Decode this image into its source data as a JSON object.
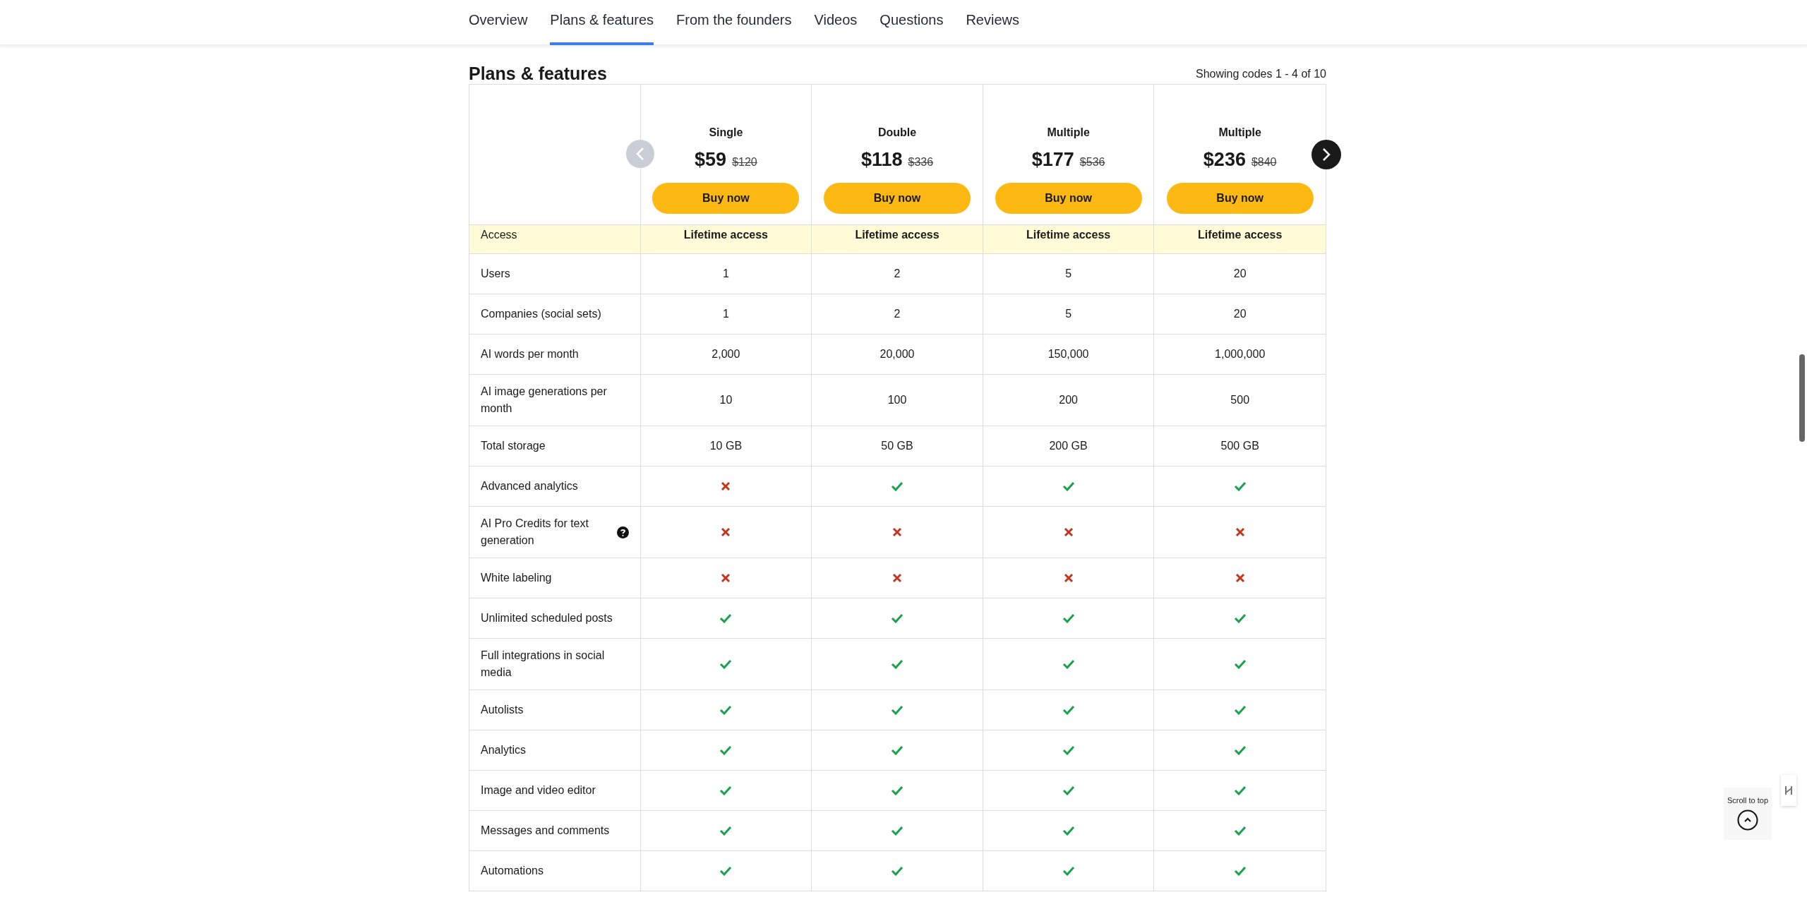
{
  "tabs": [
    {
      "label": "Overview",
      "selected": false
    },
    {
      "label": "Plans & features",
      "selected": true
    },
    {
      "label": "From the founders",
      "selected": false
    },
    {
      "label": "Videos",
      "selected": false
    },
    {
      "label": "Questions",
      "selected": false
    },
    {
      "label": "Reviews",
      "selected": false
    }
  ],
  "section_title": "Plans & features",
  "showing": "Showing codes 1 - 4 of 10",
  "carousel": {
    "prev_disabled": true,
    "next_disabled": false
  },
  "plans": [
    {
      "name": "Single",
      "price": "$59",
      "old_price": "$120",
      "button": "Buy now"
    },
    {
      "name": "Double",
      "price": "$118",
      "old_price": "$336",
      "button": "Buy now"
    },
    {
      "name": "Multiple",
      "price": "$177",
      "old_price": "$536",
      "button": "Buy now"
    },
    {
      "name": "Multiple",
      "price": "$236",
      "old_price": "$840",
      "button": "Buy now"
    }
  ],
  "rows": [
    {
      "label": "Access",
      "highlight": true,
      "help": false,
      "cells": [
        {
          "kind": "text",
          "text": "Lifetime access"
        },
        {
          "kind": "text",
          "text": "Lifetime access"
        },
        {
          "kind": "text",
          "text": "Lifetime access"
        },
        {
          "kind": "text",
          "text": "Lifetime access"
        }
      ]
    },
    {
      "label": "Users",
      "highlight": false,
      "help": false,
      "cells": [
        {
          "kind": "text",
          "text": "1"
        },
        {
          "kind": "text",
          "text": "2"
        },
        {
          "kind": "text",
          "text": "5"
        },
        {
          "kind": "text",
          "text": "20"
        }
      ]
    },
    {
      "label": "Companies (social sets)",
      "highlight": false,
      "help": false,
      "cells": [
        {
          "kind": "text",
          "text": "1"
        },
        {
          "kind": "text",
          "text": "2"
        },
        {
          "kind": "text",
          "text": "5"
        },
        {
          "kind": "text",
          "text": "20"
        }
      ]
    },
    {
      "label": "AI words per month",
      "highlight": false,
      "help": false,
      "cells": [
        {
          "kind": "text",
          "text": "2,000"
        },
        {
          "kind": "text",
          "text": "20,000"
        },
        {
          "kind": "text",
          "text": "150,000"
        },
        {
          "kind": "text",
          "text": "1,000,000"
        }
      ]
    },
    {
      "label": "AI image generations per month",
      "highlight": false,
      "help": false,
      "cells": [
        {
          "kind": "text",
          "text": "10"
        },
        {
          "kind": "text",
          "text": "100"
        },
        {
          "kind": "text",
          "text": "200"
        },
        {
          "kind": "text",
          "text": "500"
        }
      ]
    },
    {
      "label": "Total storage",
      "highlight": false,
      "help": false,
      "cells": [
        {
          "kind": "text",
          "text": "10 GB"
        },
        {
          "kind": "text",
          "text": "50 GB"
        },
        {
          "kind": "text",
          "text": "200 GB"
        },
        {
          "kind": "text",
          "text": "500 GB"
        }
      ]
    },
    {
      "label": "Advanced analytics",
      "highlight": false,
      "help": false,
      "cells": [
        {
          "kind": "cross"
        },
        {
          "kind": "check"
        },
        {
          "kind": "check"
        },
        {
          "kind": "check"
        }
      ]
    },
    {
      "label": "AI Pro Credits for text generation",
      "highlight": false,
      "help": true,
      "cells": [
        {
          "kind": "cross"
        },
        {
          "kind": "cross"
        },
        {
          "kind": "cross"
        },
        {
          "kind": "cross"
        }
      ]
    },
    {
      "label": "White labeling",
      "highlight": false,
      "help": false,
      "cells": [
        {
          "kind": "cross"
        },
        {
          "kind": "cross"
        },
        {
          "kind": "cross"
        },
        {
          "kind": "cross"
        }
      ]
    },
    {
      "label": "Unlimited scheduled posts",
      "highlight": false,
      "help": false,
      "cells": [
        {
          "kind": "check"
        },
        {
          "kind": "check"
        },
        {
          "kind": "check"
        },
        {
          "kind": "check"
        }
      ]
    },
    {
      "label": "Full integrations in social media",
      "highlight": false,
      "help": false,
      "cells": [
        {
          "kind": "check"
        },
        {
          "kind": "check"
        },
        {
          "kind": "check"
        },
        {
          "kind": "check"
        }
      ]
    },
    {
      "label": "Autolists",
      "highlight": false,
      "help": false,
      "cells": [
        {
          "kind": "check"
        },
        {
          "kind": "check"
        },
        {
          "kind": "check"
        },
        {
          "kind": "check"
        }
      ]
    },
    {
      "label": "Analytics",
      "highlight": false,
      "help": false,
      "cells": [
        {
          "kind": "check"
        },
        {
          "kind": "check"
        },
        {
          "kind": "check"
        },
        {
          "kind": "check"
        }
      ]
    },
    {
      "label": "Image and video editor",
      "highlight": false,
      "help": false,
      "cells": [
        {
          "kind": "check"
        },
        {
          "kind": "check"
        },
        {
          "kind": "check"
        },
        {
          "kind": "check"
        }
      ]
    },
    {
      "label": "Messages and comments",
      "highlight": false,
      "help": false,
      "cells": [
        {
          "kind": "check"
        },
        {
          "kind": "check"
        },
        {
          "kind": "check"
        },
        {
          "kind": "check"
        }
      ]
    },
    {
      "label": "Automations",
      "highlight": false,
      "help": false,
      "cells": [
        {
          "kind": "check"
        },
        {
          "kind": "check"
        },
        {
          "kind": "check"
        },
        {
          "kind": "check"
        }
      ]
    }
  ],
  "scroll_top": {
    "label": "Scroll to top"
  }
}
